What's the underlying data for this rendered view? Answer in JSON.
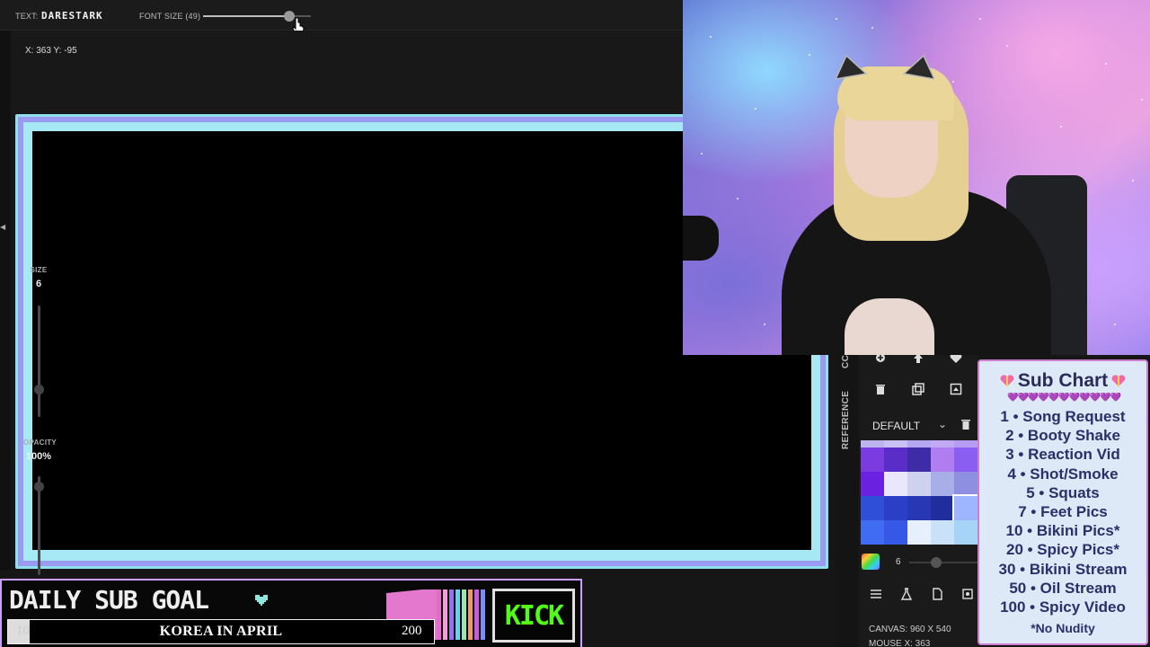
{
  "toolbar": {
    "text_label": "TEXT:",
    "text_value": "DARESTARK",
    "font_size_label": "FONT SIZE (49)"
  },
  "coords": "X: 363 Y: -95",
  "left_panel": {
    "size_label": "SIZE",
    "size_value": "6",
    "opacity_label": "OPACITY",
    "opacity_value": "100%"
  },
  "tools": {
    "tab_cc": "CC",
    "tab_reference": "REFERENCE",
    "palette_name": "DEFAULT",
    "brush_size": "6",
    "canvas_info": "CANVAS: 960 X 540",
    "mouse_info": "MOUSE X: 363",
    "swatches": [
      "#bdb3f0",
      "#c9c0f5",
      "#b6a7f3",
      "#c2a9f5",
      "#b69cf3",
      "#7a3be0",
      "#5a2dc8",
      "#3e2ba6",
      "#b17ef2",
      "#8a5ef0",
      "#6a22e0",
      "#eae6fb",
      "#cfd2ef",
      "#a8aee8",
      "#8f8fe2",
      "#2f4fd8",
      "#2a3fc6",
      "#2837b4",
      "#1f2e9c",
      "#9eb6ff",
      "#3f6cf2",
      "#3558e6",
      "#e6f0ff",
      "#c9e2fa",
      "#a6d4f7"
    ]
  },
  "subchart": {
    "title": "Sub Chart",
    "hearts": "💜💜💜💜💜💜💜💜💜💜💜",
    "items": [
      "1 • Song Request",
      "2 • Booty Shake",
      "3 • Reaction Vid",
      "4 • Shot/Smoke",
      "5 • Squats",
      "7 • Feet Pics",
      "10 • Bikini Pics*",
      "20 • Spicy Pics*",
      "30 • Bikini Stream",
      "50 • Oil Stream",
      "100 • Spicy Video"
    ],
    "note": "*No Nudity"
  },
  "goal": {
    "title": "DAILY SUB GOAL",
    "current": "10",
    "label": "KOREA IN APRIL",
    "target": "200",
    "progress": 0.05,
    "kick": "KICK",
    "stripe_colors": [
      "#e06bc8",
      "#f3a0d6",
      "#9a6ff0",
      "#6ad0f0",
      "#9ae6b4",
      "#f09a6a",
      "#c95bd8",
      "#7c8ef5"
    ]
  },
  "colors": {
    "frame_outer": "#8fe0ef",
    "frame_violet": "#9a9bf0",
    "frame_cyan": "#a6e8f4",
    "kick_green": "#53fc18"
  }
}
